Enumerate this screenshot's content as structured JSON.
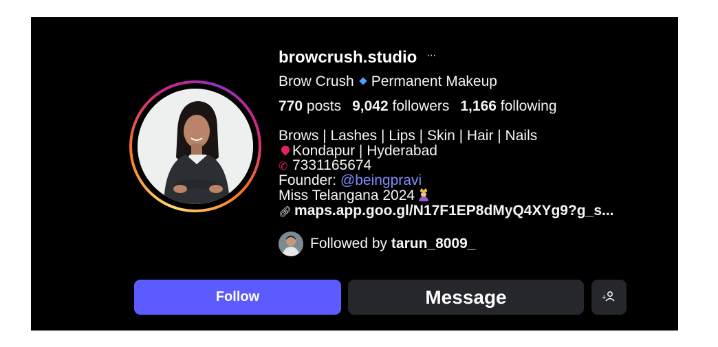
{
  "profile": {
    "username": "browcrush.studio",
    "more_icon": "ellipsis-icon",
    "full_name": "Brow Crush",
    "category": "Permanent Makeup",
    "separator_icon": "blue-diamond-icon"
  },
  "stats": {
    "posts_count": "770",
    "posts_label": "posts",
    "followers_count": "9,042",
    "followers_label": "followers",
    "following_count": "1,166",
    "following_label": "following"
  },
  "bio": {
    "line1": "Brows | Lashes | Lips | Skin | Hair | Nails",
    "line2": "Kondapur | Hyderabad",
    "line3": "7331165674",
    "line4_prefix": "Founder: ",
    "line4_mention": "@beingpravi",
    "line5": "Miss Telangana 2024",
    "link": "maps.app.goo.gl/N17F1EP8dMyQ4XYg9?g_s..."
  },
  "followed_by": {
    "prefix": "Followed by ",
    "user": "tarun_8009_"
  },
  "actions": {
    "follow_label": "Follow",
    "message_label": "Message",
    "suggest_icon": "add-person-icon"
  },
  "colors": {
    "background": "#000000",
    "follow_button": "#5b5bff",
    "secondary_button": "#25272c",
    "mention": "#7f8cff"
  }
}
